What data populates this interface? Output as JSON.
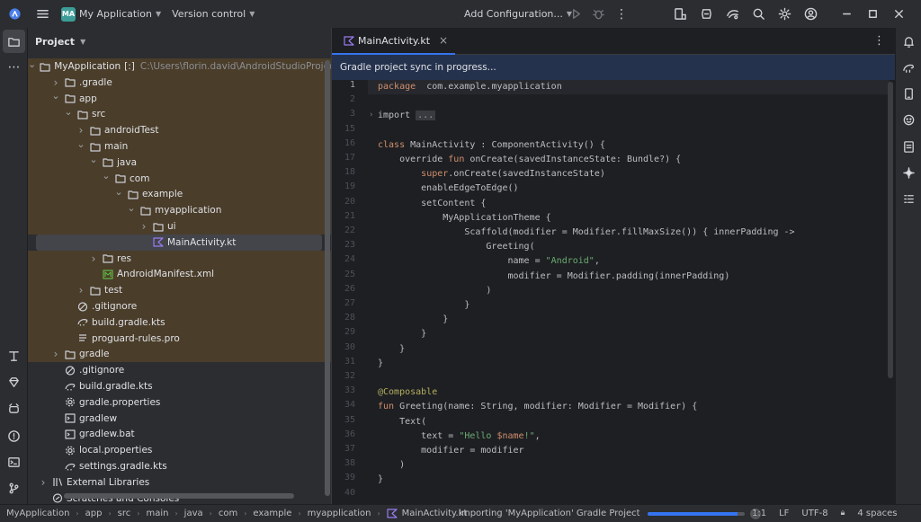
{
  "titlebar": {
    "project_badge": "MA",
    "project_name": "My Application",
    "vcs": "Version control",
    "run_config": "Add Configuration...",
    "icons": [
      "app-logo-icon",
      "hamburger-menu-icon",
      "run-icon",
      "debug-icon",
      "device-manager-icon",
      "sdk-manager-icon",
      "ai-assistant-icon",
      "search-icon",
      "settings-icon",
      "account-icon",
      "minimize-icon",
      "maximize-icon",
      "close-icon"
    ]
  },
  "left_toolbar": {
    "icons": [
      "project-icon",
      "more-icon",
      "build-icon",
      "gem-icon",
      "terminal-icon",
      "problems-icon",
      "terminal-icon",
      "git-icon"
    ]
  },
  "right_toolbar": {
    "icons": [
      "notifications-icon",
      "gradle-icon",
      "device-manager-icon",
      "emulator-icon",
      "logcat-icon",
      "gemini-icon",
      "structure-icon"
    ]
  },
  "project_panel": {
    "title": "Project",
    "tree": [
      {
        "label": "MyApplication",
        "suffix": "[:]",
        "hint": "C:\\Users\\florin.david\\AndroidStudioProjects\\My",
        "level": 0,
        "expanded": true,
        "icon": "folder",
        "hl": true
      },
      {
        "label": ".gradle",
        "level": 1,
        "expanded": false,
        "icon": "folder",
        "hl": true
      },
      {
        "label": "app",
        "level": 1,
        "expanded": true,
        "icon": "folder",
        "hl": true
      },
      {
        "label": "src",
        "level": 2,
        "expanded": true,
        "icon": "folder",
        "hl": true
      },
      {
        "label": "androidTest",
        "level": 3,
        "expanded": false,
        "icon": "folder",
        "hl": true
      },
      {
        "label": "main",
        "level": 3,
        "expanded": true,
        "icon": "folder",
        "hl": true
      },
      {
        "label": "java",
        "level": 4,
        "expanded": true,
        "icon": "folder",
        "hl": true
      },
      {
        "label": "com",
        "level": 5,
        "expanded": true,
        "icon": "folder",
        "hl": true
      },
      {
        "label": "example",
        "level": 6,
        "expanded": true,
        "icon": "folder",
        "hl": true
      },
      {
        "label": "myapplication",
        "level": 7,
        "expanded": true,
        "icon": "folder",
        "hl": true
      },
      {
        "label": "ui",
        "level": 8,
        "expanded": false,
        "icon": "folder",
        "hl": true
      },
      {
        "label": "MainActivity.kt",
        "level": 8,
        "icon": "kotlin",
        "sel": true
      },
      {
        "label": "res",
        "level": 4,
        "expanded": false,
        "icon": "folder",
        "hl": true
      },
      {
        "label": "AndroidManifest.xml",
        "level": 4,
        "icon": "manifest",
        "hl": true
      },
      {
        "label": "test",
        "level": 3,
        "expanded": false,
        "icon": "folder",
        "hl": true
      },
      {
        "label": ".gitignore",
        "level": 2,
        "icon": "ignore",
        "hl": true
      },
      {
        "label": "build.gradle.kts",
        "level": 2,
        "icon": "gradle",
        "hl": true
      },
      {
        "label": "proguard-rules.pro",
        "level": 2,
        "icon": "text",
        "hl": true
      },
      {
        "label": "gradle",
        "level": 1,
        "expanded": false,
        "icon": "folder",
        "hl": true
      },
      {
        "label": ".gitignore",
        "level": 1,
        "icon": "ignore"
      },
      {
        "label": "build.gradle.kts",
        "level": 1,
        "icon": "gradle"
      },
      {
        "label": "gradle.properties",
        "level": 1,
        "icon": "settings"
      },
      {
        "label": "gradlew",
        "level": 1,
        "icon": "exec"
      },
      {
        "label": "gradlew.bat",
        "level": 1,
        "icon": "exec"
      },
      {
        "label": "local.properties",
        "level": 1,
        "icon": "settings"
      },
      {
        "label": "settings.gradle.kts",
        "level": 1,
        "icon": "gradle"
      },
      {
        "label": "External Libraries",
        "level": 0,
        "expanded": false,
        "icon": "library"
      },
      {
        "label": "Scratches and Consoles",
        "level": 0,
        "icon": "scratch"
      }
    ]
  },
  "editor": {
    "tab_label": "MainActivity.kt",
    "tab_close": "×",
    "sync_message": "Gradle project sync in progress...",
    "lines": [
      {
        "n": "1",
        "tokens": [
          [
            "kw",
            "package"
          ],
          [
            "",
            "  com.example.myapplication"
          ]
        ]
      },
      {
        "n": "2",
        "tokens": []
      },
      {
        "n": "3",
        "tokens": [
          [
            "",
            "import "
          ],
          [
            "fold",
            "..."
          ]
        ]
      },
      {
        "n": "15",
        "tokens": []
      },
      {
        "n": "16",
        "tokens": [
          [
            "kw",
            "class"
          ],
          [
            "",
            " MainActivity : ComponentActivity() {"
          ]
        ]
      },
      {
        "n": "17",
        "tokens": [
          [
            "",
            "    override "
          ],
          [
            "kw",
            "fun"
          ],
          [
            "",
            " onCreate(savedInstanceState: Bundle?) {"
          ]
        ]
      },
      {
        "n": "18",
        "tokens": [
          [
            "",
            "        "
          ],
          [
            "kw",
            "super"
          ],
          [
            "",
            ".onCreate(savedInstanceState)"
          ]
        ]
      },
      {
        "n": "19",
        "tokens": [
          [
            "",
            "        enableEdgeToEdge()"
          ]
        ]
      },
      {
        "n": "20",
        "tokens": [
          [
            "",
            "        setContent {"
          ]
        ]
      },
      {
        "n": "21",
        "tokens": [
          [
            "",
            "            MyApplicationTheme {"
          ]
        ]
      },
      {
        "n": "22",
        "tokens": [
          [
            "",
            "                Scaffold(modifier = Modifier.fillMaxSize()) { innerPadding ->"
          ]
        ]
      },
      {
        "n": "23",
        "tokens": [
          [
            "",
            "                    Greeting("
          ]
        ]
      },
      {
        "n": "24",
        "tokens": [
          [
            "",
            "                        name = "
          ],
          [
            "str",
            "\"Android\""
          ],
          [
            "",
            ","
          ]
        ]
      },
      {
        "n": "25",
        "tokens": [
          [
            "",
            "                        modifier = Modifier.padding(innerPadding)"
          ]
        ]
      },
      {
        "n": "26",
        "tokens": [
          [
            "",
            "                    )"
          ]
        ]
      },
      {
        "n": "27",
        "tokens": [
          [
            "",
            "                }"
          ]
        ]
      },
      {
        "n": "28",
        "tokens": [
          [
            "",
            "            }"
          ]
        ]
      },
      {
        "n": "29",
        "tokens": [
          [
            "",
            "        }"
          ]
        ]
      },
      {
        "n": "30",
        "tokens": [
          [
            "",
            "    }"
          ]
        ]
      },
      {
        "n": "31",
        "tokens": [
          [
            "",
            "}"
          ]
        ]
      },
      {
        "n": "32",
        "tokens": []
      },
      {
        "n": "33",
        "tokens": [
          [
            "ann",
            "@Composable"
          ]
        ]
      },
      {
        "n": "34",
        "tokens": [
          [
            "kw",
            "fun"
          ],
          [
            "",
            " Greeting(name: String, modifier: Modifier = Modifier) {"
          ]
        ]
      },
      {
        "n": "35",
        "tokens": [
          [
            "",
            "    Text("
          ]
        ]
      },
      {
        "n": "36",
        "tokens": [
          [
            "",
            "        text = "
          ],
          [
            "str",
            "\"Hello "
          ],
          [
            "kw",
            "$name"
          ],
          [
            "str",
            "!\""
          ],
          [
            "",
            ","
          ]
        ]
      },
      {
        "n": "37",
        "tokens": [
          [
            "",
            "        modifier = modifier"
          ]
        ]
      },
      {
        "n": "38",
        "tokens": [
          [
            "",
            "    )"
          ]
        ]
      },
      {
        "n": "39",
        "tokens": [
          [
            "",
            "}"
          ]
        ]
      },
      {
        "n": "40",
        "tokens": []
      }
    ]
  },
  "statusbar": {
    "breadcrumbs": [
      "MyApplication",
      "app",
      "src",
      "main",
      "java",
      "com",
      "example",
      "myapplication",
      "MainActivity.kt"
    ],
    "task": "Importing 'MyApplication' Gradle Project",
    "progress": 0.93,
    "position": "1:1",
    "line_sep": "LF",
    "encoding": "UTF-8",
    "indent": "4 spaces"
  }
}
